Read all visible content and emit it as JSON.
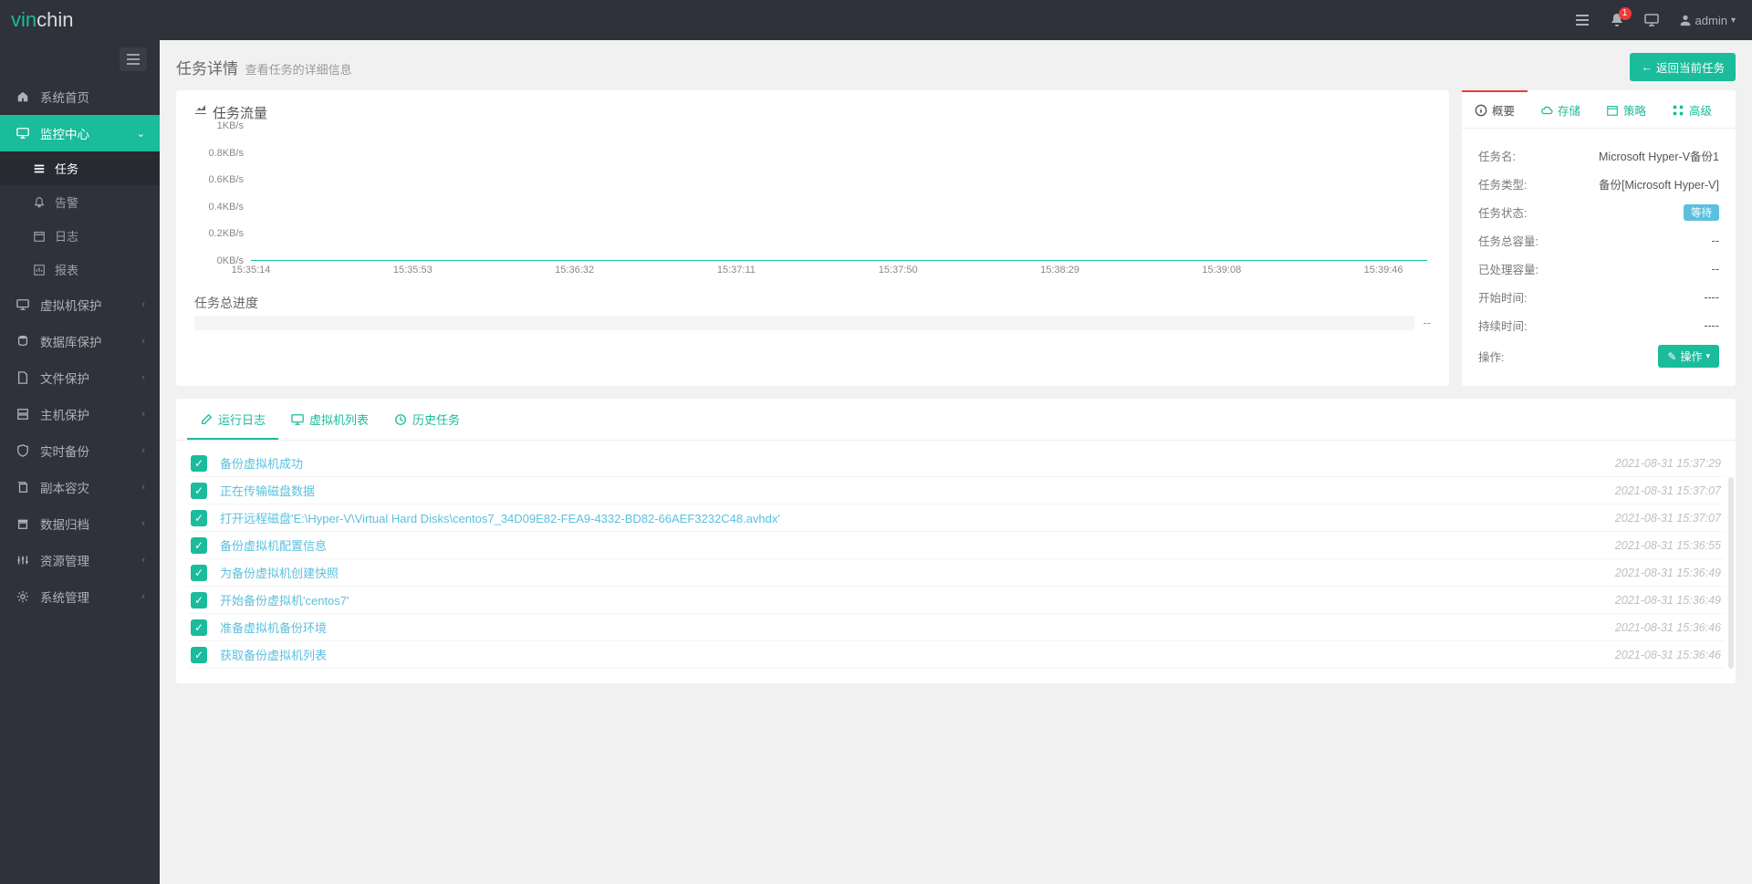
{
  "brand": "vinchin",
  "topbar": {
    "notif_count": "1",
    "user": "admin"
  },
  "sidebar": {
    "items": [
      {
        "icon": "home",
        "label": "系统首页",
        "children": null
      },
      {
        "icon": "monitor",
        "label": "监控中心",
        "active": true,
        "children": [
          {
            "icon": "bars",
            "label": "任务",
            "active": true
          },
          {
            "icon": "bell",
            "label": "告警"
          },
          {
            "icon": "calendar",
            "label": "日志"
          },
          {
            "icon": "report",
            "label": "报表"
          }
        ]
      },
      {
        "icon": "monitor",
        "label": "虚拟机保护"
      },
      {
        "icon": "db",
        "label": "数据库保护"
      },
      {
        "icon": "file",
        "label": "文件保护"
      },
      {
        "icon": "server",
        "label": "主机保护"
      },
      {
        "icon": "shield",
        "label": "实时备份"
      },
      {
        "icon": "copy",
        "label": "副本容灾"
      },
      {
        "icon": "archive",
        "label": "数据归档"
      },
      {
        "icon": "sliders",
        "label": "资源管理"
      },
      {
        "icon": "gear",
        "label": "系统管理"
      }
    ]
  },
  "header": {
    "title": "任务详情",
    "subtitle": "查看任务的详细信息",
    "back_btn": "返回当前任务"
  },
  "chart_title": "任务流量",
  "chart_data": {
    "type": "line",
    "x": [
      "15:35:14",
      "15:35:53",
      "15:36:32",
      "15:37:11",
      "15:37:50",
      "15:38:29",
      "15:39:08",
      "15:39:46"
    ],
    "y": [
      0,
      0,
      0,
      0,
      0,
      0,
      0,
      0
    ],
    "ylabel": "",
    "y_ticks": [
      "0KB/s",
      "0.2KB/s",
      "0.4KB/s",
      "0.6KB/s",
      "0.8KB/s",
      "1KB/s"
    ],
    "ylim": [
      0,
      1
    ]
  },
  "progress": {
    "title": "任务总进度",
    "value": "--"
  },
  "overview": {
    "tabs": [
      {
        "icon": "info",
        "label": "概要",
        "active": true
      },
      {
        "icon": "cloud",
        "label": "存储"
      },
      {
        "icon": "cal",
        "label": "策略"
      },
      {
        "icon": "grid",
        "label": "高级"
      }
    ],
    "rows": [
      {
        "k": "任务名:",
        "v": "Microsoft Hyper-V备份1"
      },
      {
        "k": "任务类型:",
        "v": "备份[Microsoft Hyper-V]"
      },
      {
        "k": "任务状态:",
        "v": "等待",
        "badge": true
      },
      {
        "k": "任务总容量:",
        "v": "--"
      },
      {
        "k": "已处理容量:",
        "v": "--"
      },
      {
        "k": "开始时间:",
        "v": "----"
      },
      {
        "k": "持续时间:",
        "v": "----"
      },
      {
        "k": "操作:",
        "btn": "操作"
      }
    ]
  },
  "bottom_tabs": [
    {
      "icon": "edit",
      "label": "运行日志",
      "active": true
    },
    {
      "icon": "monitor",
      "label": "虚拟机列表"
    },
    {
      "icon": "history",
      "label": "历史任务"
    }
  ],
  "logs": [
    {
      "msg": "备份虚拟机成功",
      "t": "2021-08-31 15:37:29"
    },
    {
      "msg": "正在传输磁盘数据",
      "t": "2021-08-31 15:37:07"
    },
    {
      "msg": "打开远程磁盘'E:\\Hyper-V\\Virtual Hard Disks\\centos7_34D09E82-FEA9-4332-BD82-66AEF3232C48.avhdx'",
      "t": "2021-08-31 15:37:07"
    },
    {
      "msg": "备份虚拟机配置信息",
      "t": "2021-08-31 15:36:55"
    },
    {
      "msg": "为备份虚拟机创建快照",
      "t": "2021-08-31 15:36:49"
    },
    {
      "msg": "开始备份虚拟机'centos7'",
      "t": "2021-08-31 15:36:49"
    },
    {
      "msg": "准备虚拟机备份环境",
      "t": "2021-08-31 15:36:46"
    },
    {
      "msg": "获取备份虚拟机列表",
      "t": "2021-08-31 15:36:46"
    }
  ]
}
